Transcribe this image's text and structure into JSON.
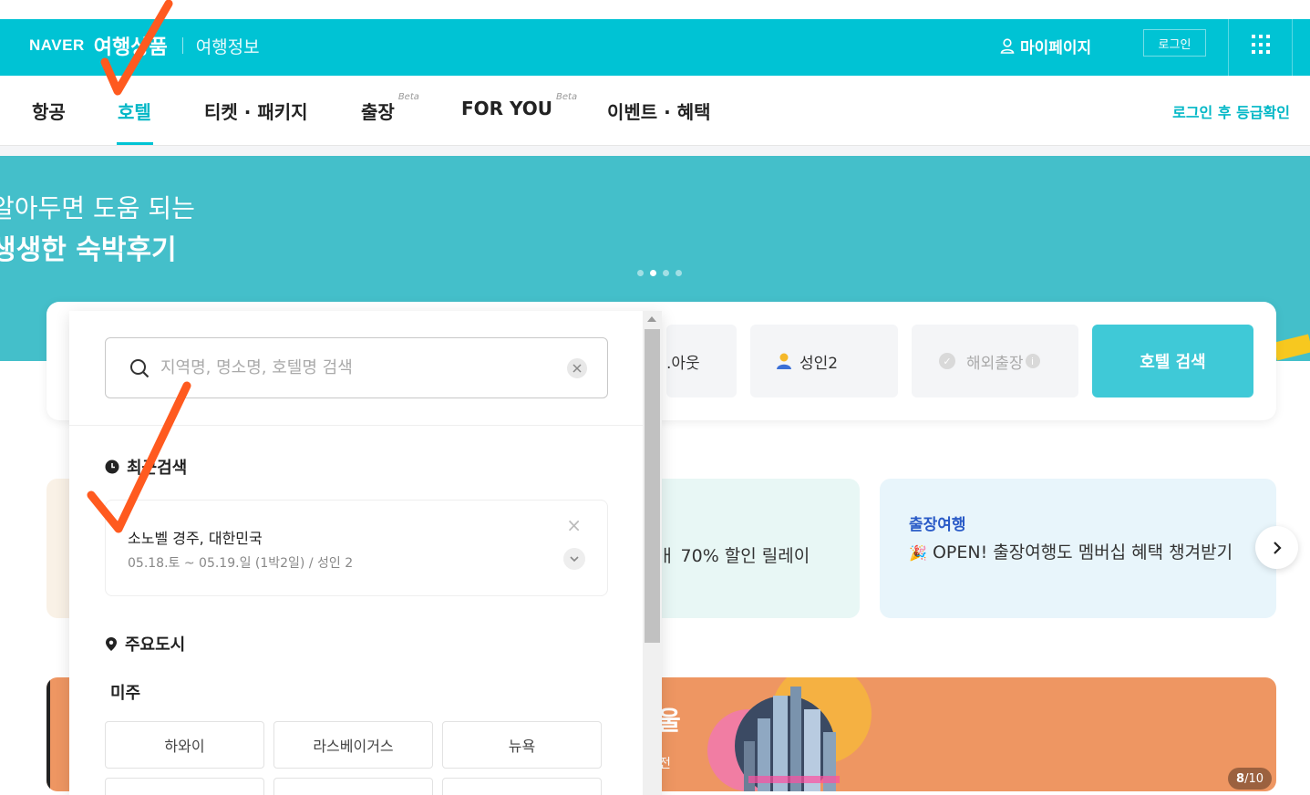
{
  "header": {
    "naver_logo": "NAVER",
    "product_title": "여행상품",
    "travel_info": "여행정보",
    "mypage_label": "마이페이지",
    "login_label": "로그인"
  },
  "nav": {
    "items": [
      {
        "label": "항공"
      },
      {
        "label": "호텔"
      },
      {
        "label": "티켓 · 패키지"
      },
      {
        "label": "출장",
        "badge": "Beta"
      },
      {
        "label": "FOR YOU",
        "badge": "Beta"
      },
      {
        "label": "이벤트 · 혜택"
      }
    ],
    "active": "호텔",
    "grade_link": "로그인 후 등급확인"
  },
  "banner": {
    "line1": "알아두면 도움 되는",
    "line2": "생생한 숙박후기",
    "slide_count": 4,
    "active_slide": 2
  },
  "search_card": {
    "checkout_partial": ".아웃",
    "guests": "성인2",
    "business_trip": "해외출장",
    "search_button": "호텔 검색"
  },
  "dropdown": {
    "search_placeholder": "지역명, 명소명, 호텔명 검색",
    "recent_heading": "최근검색",
    "recent_item": {
      "name": "소노벨 경주, 대한민국",
      "meta": "05.18.토 ~ 05.19.일 (1박2일) / 성인 2"
    },
    "major_cities_heading": "주요도시",
    "region": "미주",
    "cities": [
      "하와이",
      "라스베이거스",
      "뉴욕"
    ]
  },
  "promos": {
    "middle_text": "ㅐ 70% 할인 릴레이",
    "right_tag": "출장여행",
    "right_body": "OPEN! 출장여행도 멤버십 혜택 챙겨받기"
  },
  "bottom_banner": {
    "text_partial": "울",
    "sub_partial": "전",
    "pager_current": "8",
    "pager_total": "/10"
  },
  "colors": {
    "header_bg": "#00c3d4",
    "accent": "#00b7c6",
    "banner_bg": "#44bfca",
    "search_button": "#3fc9d7",
    "annotation_check": "#ff5a1f"
  }
}
